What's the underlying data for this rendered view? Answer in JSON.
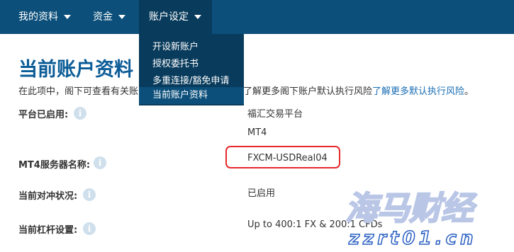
{
  "nav": {
    "items": [
      {
        "label": "我的资料"
      },
      {
        "label": "资金"
      },
      {
        "label": "账户设定"
      }
    ],
    "dropdown": [
      {
        "label": "开设新账户"
      },
      {
        "label": "授权委托书"
      },
      {
        "label": "多重连接/豁免申请"
      },
      {
        "label": "当前账户资料"
      }
    ]
  },
  "page": {
    "title": "当前账户资料",
    "intro_start": "在此项中，阁下可查看有关账",
    "intro_tail": "了解更多阁下账户默认执行风险",
    "intro_link": "了解更多默认执行风险",
    "intro_end": "。"
  },
  "fields": [
    {
      "label": "平台已启用:",
      "values": [
        "福汇交易平台",
        "MT4"
      ]
    },
    {
      "label": "MT4服务器名称:",
      "values": [
        "FXCM-USDReal04"
      ]
    },
    {
      "label": "当前对冲状况:",
      "values": [
        "已启用"
      ]
    },
    {
      "label": "当前杠杆设置:",
      "values": [
        "Up to 400:1 FX & 200:1 CFDs"
      ]
    }
  ],
  "icons": {
    "info": "info-icon",
    "caret": "chevron-down-icon"
  },
  "colors": {
    "nav_bg": "#0b4f7a",
    "dropdown_bg": "#083b5c",
    "title": "#0b5c97",
    "link": "#1a6db3",
    "highlight": "#e8292c"
  },
  "watermark": {
    "text": "海马财经",
    "url": "zzrt01.cn"
  }
}
